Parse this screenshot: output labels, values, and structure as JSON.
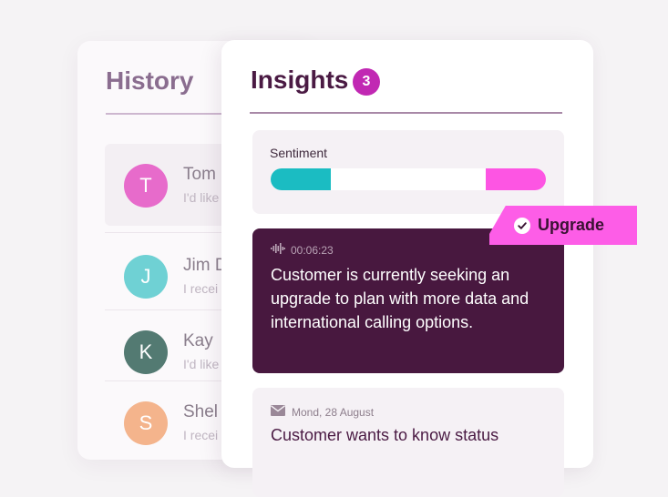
{
  "history": {
    "title": "History",
    "items": [
      {
        "initial": "T",
        "name": "Tom",
        "snippet": "I'd like",
        "color": "#e76bcb"
      },
      {
        "initial": "J",
        "name": "Jim D",
        "snippet": "I recei",
        "color": "#6fd1d4"
      },
      {
        "initial": "K",
        "name": "Kay",
        "snippet": "I'd like",
        "color": "#537a72"
      },
      {
        "initial": "S",
        "name": "Shel",
        "snippet": "I recei",
        "color": "#f4b48c"
      }
    ]
  },
  "insights": {
    "title": "Insights",
    "badge_count": "3",
    "sentiment": {
      "label": "Sentiment",
      "negative_fraction": 0.22,
      "positive_fraction": 0.22,
      "negative_color": "#1bbcc2",
      "positive_color": "#fd55e3"
    },
    "transcript": {
      "icon": "audio-wave-icon",
      "timestamp": "00:06:23",
      "text": "Customer is currently seeking an upgrade to plan with more data and international calling options."
    },
    "email": {
      "icon": "envelope-icon",
      "date": "Mond, 28 August",
      "text": "Customer wants to know status"
    }
  },
  "tag": {
    "label": "Upgrade",
    "icon": "check-circle-icon",
    "color": "#fd5de7"
  },
  "colors": {
    "accent": "#c128b3",
    "dark_card": "#48183f",
    "title": "#4a1a43"
  }
}
